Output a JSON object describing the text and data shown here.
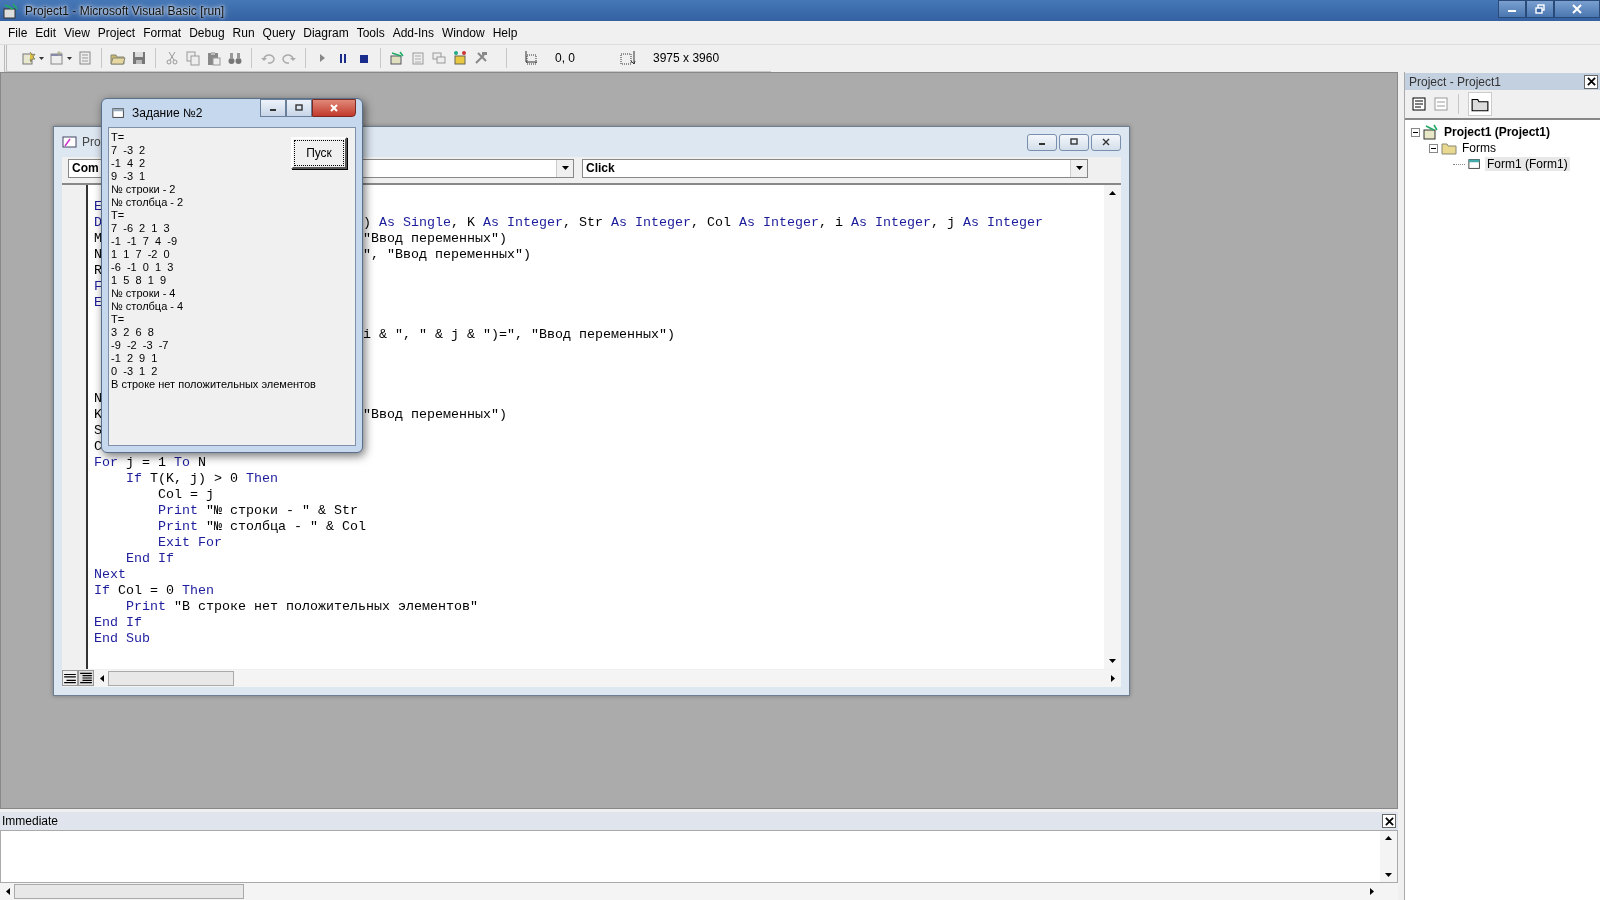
{
  "window": {
    "title": "Project1 - Microsoft Visual Basic [run]"
  },
  "menu": [
    "File",
    "Edit",
    "View",
    "Project",
    "Format",
    "Debug",
    "Run",
    "Query",
    "Diagram",
    "Tools",
    "Add-Ins",
    "Window",
    "Help"
  ],
  "toolbar": {
    "position": "0, 0",
    "size": "3975 x 3960"
  },
  "code_window": {
    "title": "Pro",
    "object_combo": "Com",
    "procedure_combo": "Click",
    "lines": [
      {
        "kind": "code",
        "left": [
          {
            "text": "E",
            "kind": "keyword"
          }
        ]
      },
      {
        "kind": "code",
        "left": [
          {
            "text": "D",
            "kind": "keyword"
          }
        ],
        "right": [
          {
            "text": ") ",
            "kind": "plain"
          },
          {
            "text": "As Single",
            "kind": "keyword"
          },
          {
            "text": ", K ",
            "kind": "plain"
          },
          {
            "text": "As Integer",
            "kind": "keyword"
          },
          {
            "text": ", Str ",
            "kind": "plain"
          },
          {
            "text": "As Integer",
            "kind": "keyword"
          },
          {
            "text": ", Col ",
            "kind": "plain"
          },
          {
            "text": "As Integer",
            "kind": "keyword"
          },
          {
            "text": ", i ",
            "kind": "plain"
          },
          {
            "text": "As Integer",
            "kind": "keyword"
          },
          {
            "text": ", j ",
            "kind": "plain"
          },
          {
            "text": "As Integer",
            "kind": "keyword"
          }
        ]
      },
      {
        "kind": "code",
        "left": [
          {
            "text": "M",
            "kind": "plain"
          }
        ],
        "right": [
          {
            "text": "\"Ввод переменных\")",
            "kind": "plain"
          }
        ]
      },
      {
        "kind": "code",
        "left": [
          {
            "text": "N",
            "kind": "plain"
          }
        ],
        "right": [
          {
            "text": "\", \"Ввод переменных\")",
            "kind": "plain"
          }
        ]
      },
      {
        "kind": "code",
        "left": [
          {
            "text": "R",
            "kind": "plain"
          }
        ]
      },
      {
        "kind": "code",
        "left": [
          {
            "text": "F",
            "kind": "keyword"
          }
        ]
      },
      {
        "kind": "code",
        "left": [
          {
            "text": "E",
            "kind": "keyword"
          }
        ]
      },
      {
        "kind": "blank"
      },
      {
        "kind": "code",
        "right": [
          {
            "text": "i & \", \" & j & \")=\", \"Ввод переменных\")",
            "kind": "plain"
          }
        ]
      },
      {
        "kind": "blank"
      },
      {
        "kind": "blank"
      },
      {
        "kind": "blank"
      },
      {
        "kind": "code",
        "left": [
          {
            "text": "N",
            "kind": "plain"
          }
        ]
      },
      {
        "kind": "code",
        "left": [
          {
            "text": "K",
            "kind": "plain"
          }
        ],
        "right": [
          {
            "text": "\"Ввод переменных\")",
            "kind": "plain"
          }
        ]
      },
      {
        "kind": "code",
        "left": [
          {
            "text": "S",
            "kind": "plain"
          }
        ]
      },
      {
        "kind": "code",
        "left": [
          {
            "text": "C",
            "kind": "plain"
          }
        ]
      },
      {
        "kind": "code",
        "left": [
          {
            "text": "For",
            "kind": "keyword"
          },
          {
            "text": " j = 1 ",
            "kind": "plain"
          },
          {
            "text": "To",
            "kind": "keyword"
          },
          {
            "text": " N",
            "kind": "plain"
          }
        ]
      },
      {
        "kind": "code",
        "left": [
          {
            "text": "    If",
            "kind": "keyword"
          },
          {
            "text": " T(K, j) > 0 ",
            "kind": "plain"
          },
          {
            "text": "Then",
            "kind": "keyword"
          }
        ]
      },
      {
        "kind": "code",
        "left": [
          {
            "text": "        Col = j",
            "kind": "plain"
          }
        ]
      },
      {
        "kind": "code",
        "left": [
          {
            "text": "        Print",
            "kind": "keyword"
          },
          {
            "text": " \"№ строки - \" & Str",
            "kind": "plain"
          }
        ]
      },
      {
        "kind": "code",
        "left": [
          {
            "text": "        Print",
            "kind": "keyword"
          },
          {
            "text": " \"№ столбца - \" & Col",
            "kind": "plain"
          }
        ]
      },
      {
        "kind": "code",
        "left": [
          {
            "text": "        Exit For",
            "kind": "keyword"
          }
        ]
      },
      {
        "kind": "code",
        "left": [
          {
            "text": "    End If",
            "kind": "keyword"
          }
        ]
      },
      {
        "kind": "code",
        "left": [
          {
            "text": "Next",
            "kind": "keyword"
          }
        ]
      },
      {
        "kind": "code",
        "left": [
          {
            "text": "If",
            "kind": "keyword"
          },
          {
            "text": " Col = 0 ",
            "kind": "plain"
          },
          {
            "text": "Then",
            "kind": "keyword"
          }
        ]
      },
      {
        "kind": "code",
        "left": [
          {
            "text": "    Print",
            "kind": "keyword"
          },
          {
            "text": " \"В строке нет положительных элементов\"",
            "kind": "plain"
          }
        ]
      },
      {
        "kind": "code",
        "left": [
          {
            "text": "End If",
            "kind": "keyword"
          }
        ]
      },
      {
        "kind": "code",
        "left": [
          {
            "text": "End Sub",
            "kind": "keyword"
          }
        ]
      }
    ]
  },
  "form_window": {
    "title": "Задание №2",
    "button": "Пуск",
    "output": [
      "T=",
      "7  -3  2",
      "-1  4  2",
      "9  -3  1",
      "№ строки - 2",
      "№ столбца - 2",
      "T=",
      "7  -6  2  1  3",
      "-1  -1  7  4  -9",
      "1  1  7  -2  0",
      "-6  -1  0  1  3",
      "1  5  8  1  9",
      "№ строки - 4",
      "№ столбца - 4",
      "T=",
      "3  2  6  8",
      "-9  -2  -3  -7",
      "-1  2  9  1",
      "0  -3  1  2",
      "В строке нет положительных элементов"
    ]
  },
  "project_explorer": {
    "title": "Project - Project1",
    "tree": [
      {
        "label": "Project1 (Project1)",
        "kind": "project",
        "expanded": true,
        "selected": false,
        "children": [
          {
            "label": "Forms",
            "kind": "folder",
            "expanded": true,
            "selected": false,
            "children": [
              {
                "label": "Form1 (Form1)",
                "kind": "form",
                "selected": true
              }
            ]
          }
        ]
      }
    ]
  },
  "immediate": {
    "title": "Immediate"
  }
}
